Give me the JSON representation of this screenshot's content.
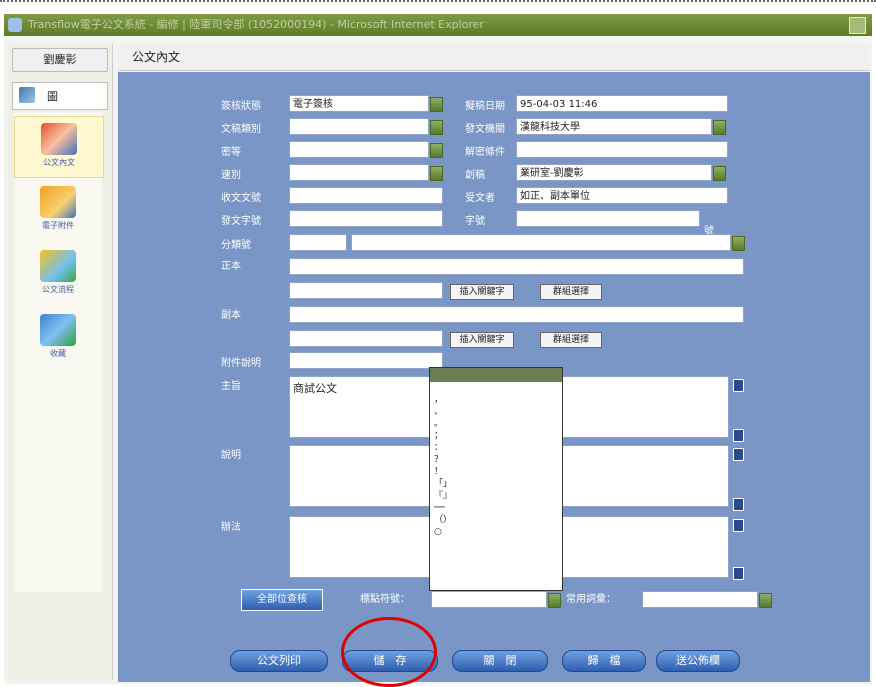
{
  "window": {
    "title": "Transflow電子公文系統 - 編修 | 陸軍司令部 (1052000194) - Microsoft Internet Explorer"
  },
  "sidebar": {
    "user_tab": "劉慶彰",
    "view_label": "圖",
    "items": [
      {
        "label": "公文內文",
        "icon": "document-icon",
        "active": true
      },
      {
        "label": "電子附件",
        "icon": "folder-icon",
        "active": false
      },
      {
        "label": "公文流程",
        "icon": "flow-icon",
        "active": false
      },
      {
        "label": "收藏",
        "icon": "download-icon",
        "active": false
      }
    ]
  },
  "header": {
    "title": "公文內文"
  },
  "form": {
    "status_label": "簽核狀態",
    "status_value": "電子簽核",
    "doc_type_label": "文稿類別",
    "doc_type_value": "",
    "secret_label": "密等",
    "secret_value": "",
    "speed_label": "速別",
    "speed_value": "",
    "recv_no_label": "收文文號",
    "recv_no_value": "",
    "send_no_label": "發文字號",
    "send_no_value": "",
    "class_no_label": "分類號",
    "original_label": "正本",
    "copy_label": "副本",
    "attach_label": "附件說明",
    "subject_label": "主旨",
    "subject_value": "商試公文",
    "explain_label": "說明",
    "method_label": "辦法",
    "draft_date_label": "擬稿日期",
    "draft_date_value": "95-04-03 11:46",
    "issuer_label": "發文機關",
    "issuer_value": "漢龍科技大學",
    "decl_label": "解密條件",
    "decl_value": "",
    "drafter_label": "創稿",
    "drafter_value": "業研室-劉慶彰",
    "receiver_label": "受文者",
    "receiver_value": "如正、副本單位",
    "word_label": "字號",
    "word_value": "",
    "hao": "號",
    "insert_keyword": "插入關鍵字",
    "group_select": "群組選擇",
    "all_units": "全部位查核",
    "punct_label": "標點符號：",
    "phrase_label": "常用詞彙："
  },
  "dropdown_options": [
    "",
    "，",
    "、",
    "。",
    "；",
    "：",
    "？",
    "！",
    "「」",
    "『』",
    "──",
    "（）",
    "○"
  ],
  "buttons": {
    "print": "公文列印",
    "save": "儲　存",
    "close": "關　閉",
    "archive": "歸　檔",
    "transfer": "送公佈欄"
  }
}
